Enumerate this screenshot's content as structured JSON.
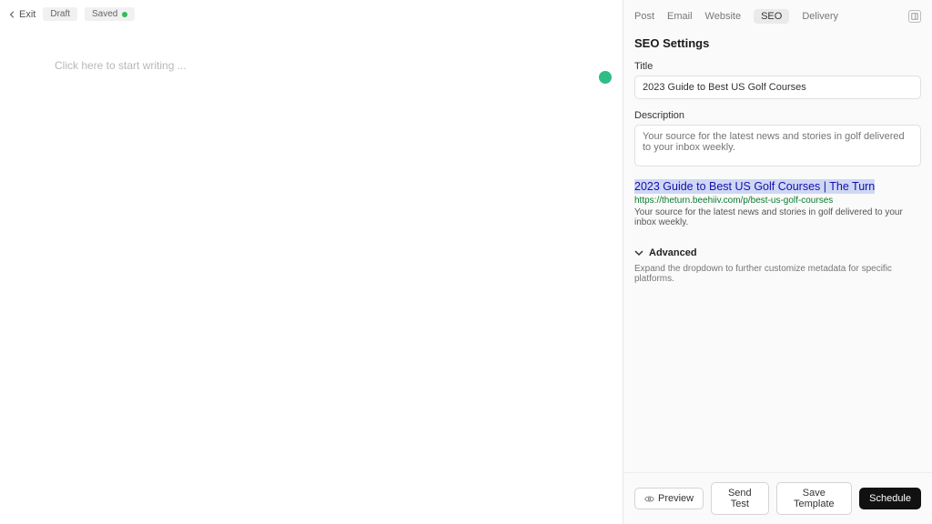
{
  "editor": {
    "exit_label": "Exit",
    "status_draft": "Draft",
    "status_saved": "Saved",
    "placeholder": "Click here to start writing ..."
  },
  "panel": {
    "tabs": {
      "post": "Post",
      "email": "Email",
      "website": "Website",
      "seo": "SEO",
      "delivery": "Delivery"
    },
    "section_title": "SEO Settings",
    "title_label": "Title",
    "title_value": "2023 Guide to Best US Golf Courses",
    "description_label": "Description",
    "description_placeholder": "Your source for the latest news and stories in golf delivered to your inbox weekly.",
    "serp": {
      "title": "2023 Guide to Best US Golf Courses | The Turn",
      "url": "https://theturn.beehiiv.com/p/best-us-golf-courses",
      "desc": "Your source for the latest news and stories in golf delivered to your inbox weekly."
    },
    "advanced_label": "Advanced",
    "advanced_help": "Expand the dropdown to further customize metadata for specific platforms."
  },
  "actions": {
    "preview": "Preview",
    "send_test": "Send Test",
    "save_template": "Save Template",
    "schedule": "Schedule"
  }
}
